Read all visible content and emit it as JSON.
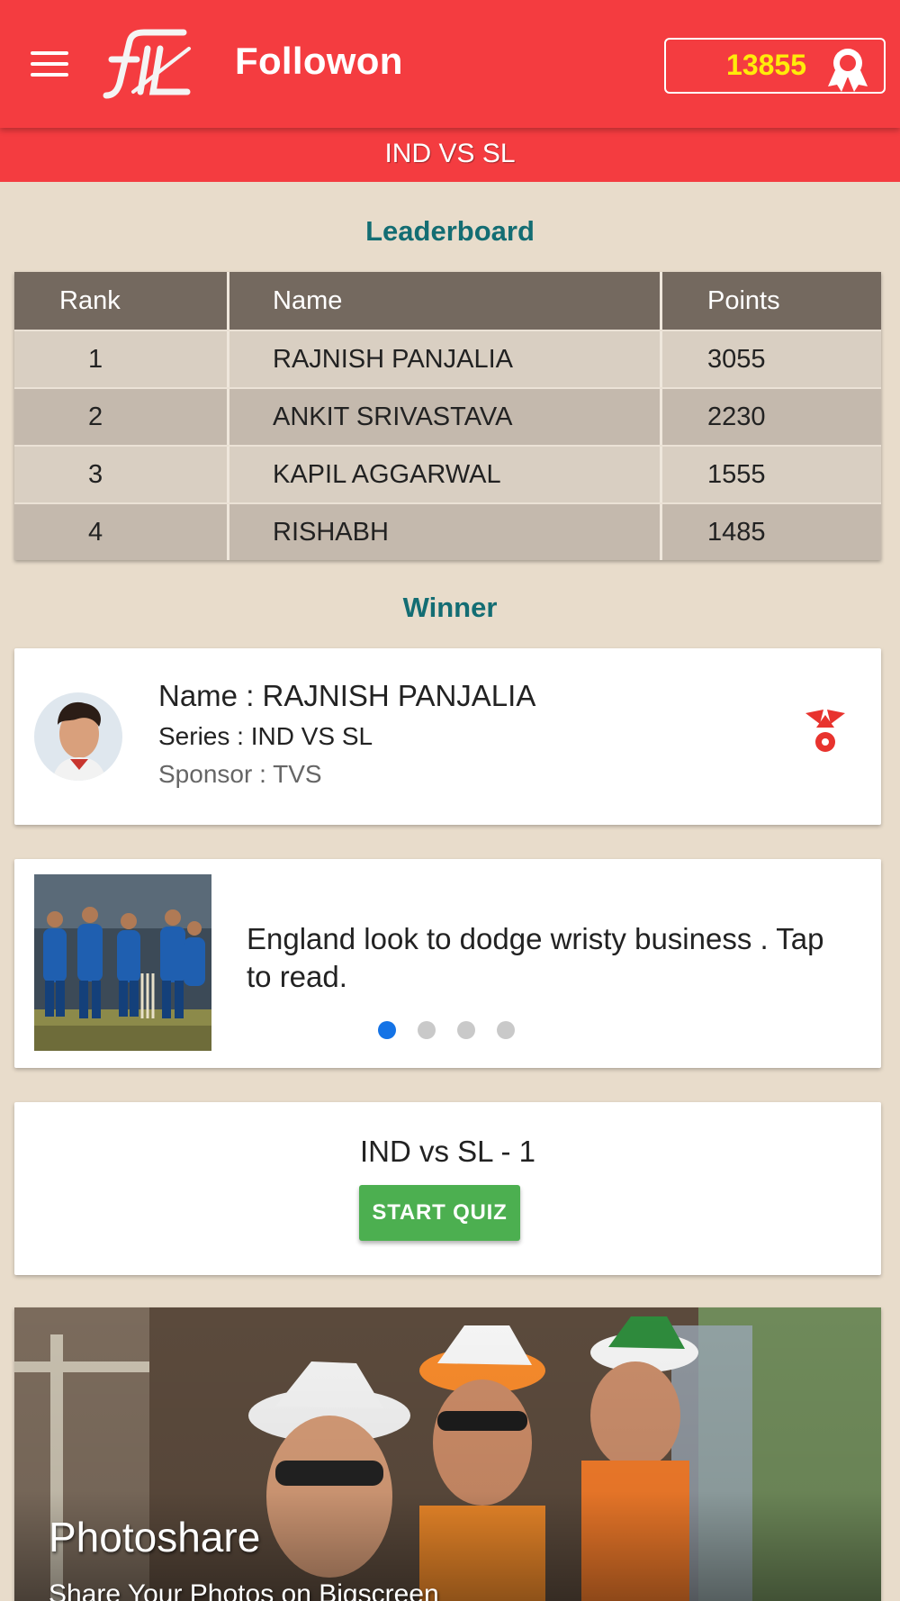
{
  "appbar": {
    "title": "Followon",
    "logo_text": "fTL",
    "points": "13855"
  },
  "subbar": {
    "title": "IND VS SL"
  },
  "leaderboard": {
    "heading": "Leaderboard",
    "columns": [
      "Rank",
      "Name",
      "Points"
    ],
    "rows": [
      {
        "rank": "1",
        "name": "RAJNISH PANJALIA",
        "points": "3055"
      },
      {
        "rank": "2",
        "name": "ANKIT SRIVASTAVA",
        "points": "2230"
      },
      {
        "rank": "3",
        "name": "KAPIL AGGARWAL",
        "points": "1555"
      },
      {
        "rank": "4",
        "name": "RISHABH",
        "points": "1485"
      }
    ]
  },
  "winner": {
    "heading": "Winner",
    "name": "Name : RAJNISH PANJALIA",
    "series": "Series : IND VS SL",
    "sponsor": "Sponsor : TVS"
  },
  "news": {
    "headline": "England look to dodge wristy business . Tap to read.",
    "slides_total": 4,
    "active_slide": 1
  },
  "quiz": {
    "title": "IND vs SL - 1",
    "button_label": "START QUIZ"
  },
  "photoshare": {
    "title": "Photoshare",
    "subtitle": "Share Your Photos on Bigscreen"
  },
  "colors": {
    "primary": "#f43c40",
    "points_text": "#ffeb0a",
    "heading": "#136d73",
    "table_header": "#74695f",
    "button": "#4caf50",
    "active_dot": "#1473e6",
    "background": "#e8dccb"
  },
  "icons": {
    "menu": "hamburger-menu-icon",
    "award": "award-ribbon-icon",
    "sponsor": "tvs-logo-icon"
  }
}
